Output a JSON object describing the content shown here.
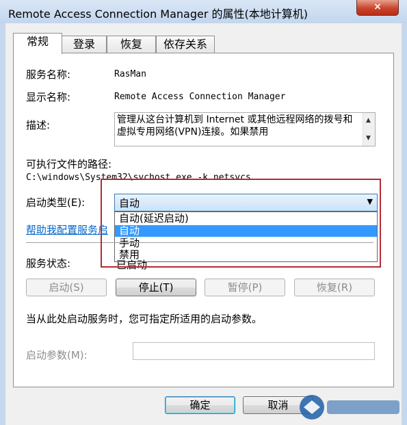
{
  "window": {
    "title": "Remote Access Connection Manager 的属性(本地计算机)",
    "close": "×"
  },
  "tabs": [
    {
      "label": "常规",
      "active": true
    },
    {
      "label": "登录",
      "active": false
    },
    {
      "label": "恢复",
      "active": false
    },
    {
      "label": "依存关系",
      "active": false
    }
  ],
  "general": {
    "service_name_label": "服务名称:",
    "service_name": "RasMan",
    "display_name_label": "显示名称:",
    "display_name": "Remote Access Connection Manager",
    "description_label": "描述:",
    "description": "管理从这台计算机到 Internet 或其他远程网络的拨号和虚拟专用网络(VPN)连接。如果禁用",
    "exe_path_label": "可执行文件的路径:",
    "exe_path": "C:\\windows\\System32\\svchost.exe -k netsvcs",
    "startup_type_label": "启动类型(E):",
    "startup_type_value": "自动",
    "startup_options": [
      "自动(延迟启动)",
      "自动",
      "手动",
      "禁用"
    ],
    "startup_selected_index": 1,
    "help_link": "帮助我配置服务启",
    "service_status_label": "服务状态:",
    "service_status": "已启动"
  },
  "control_buttons": {
    "start": "启动(S)",
    "stop": "停止(T)",
    "pause": "暂停(P)",
    "resume": "恢复(R)"
  },
  "hint": "当从此处启动服务时，您可指定所适用的启动参数。",
  "params_label": "启动参数(M):",
  "params_value": "",
  "dialog_buttons": {
    "ok": "确定",
    "cancel": "取消"
  },
  "colors": {
    "highlight": "#3399ff",
    "annotation_frame": "#b42a33",
    "link": "#0066cc"
  }
}
